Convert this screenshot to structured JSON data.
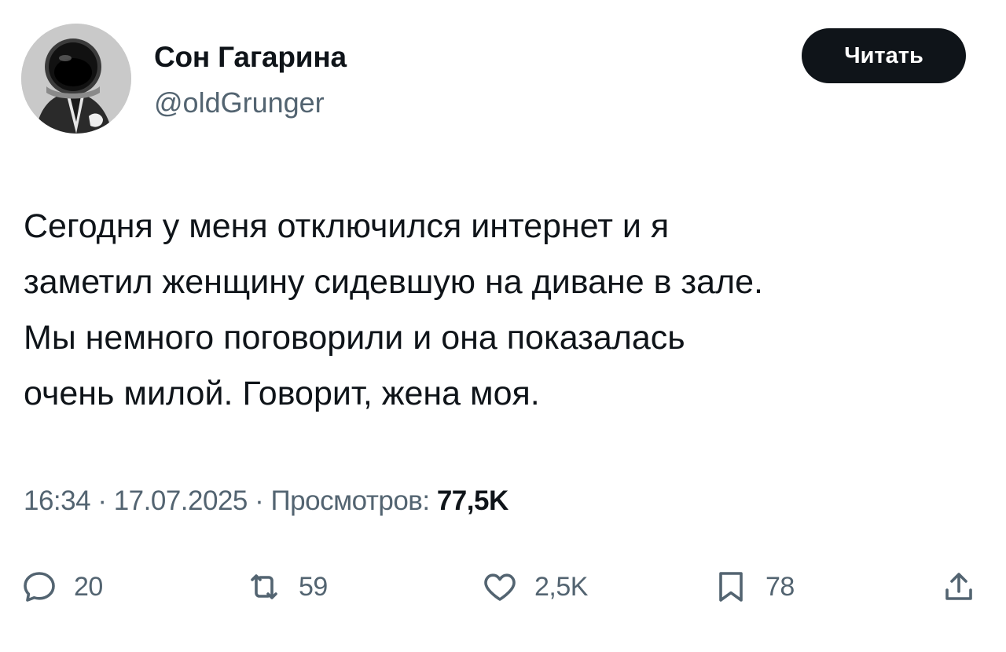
{
  "author": {
    "display_name": "Сон Гагарина",
    "handle": "@oldGrunger",
    "avatar_icon": "astronaut-avatar"
  },
  "follow_button": {
    "label": "Читать"
  },
  "tweet": {
    "text": "Сегодня у меня отключился интернет и я\nзаметил женщину сидевшую на диване в зале.\nМы немного поговорили и она показалась\nочень милой. Говорит, жена моя."
  },
  "meta": {
    "time": "16:34",
    "separator": " · ",
    "date": "17.07.2025",
    "views_label": "Просмотров:",
    "views_count": "77,5K"
  },
  "actions": {
    "reply": {
      "icon": "reply-icon",
      "count": "20"
    },
    "repost": {
      "icon": "repost-icon",
      "count": "59"
    },
    "like": {
      "icon": "heart-icon",
      "count": "2,5K"
    },
    "bookmark": {
      "icon": "bookmark-icon",
      "count": "78"
    },
    "share": {
      "icon": "share-icon"
    }
  },
  "colors": {
    "text_primary": "#0f1419",
    "text_secondary": "#536471",
    "button_bg": "#0f1419",
    "button_text": "#ffffff",
    "background": "#ffffff"
  }
}
